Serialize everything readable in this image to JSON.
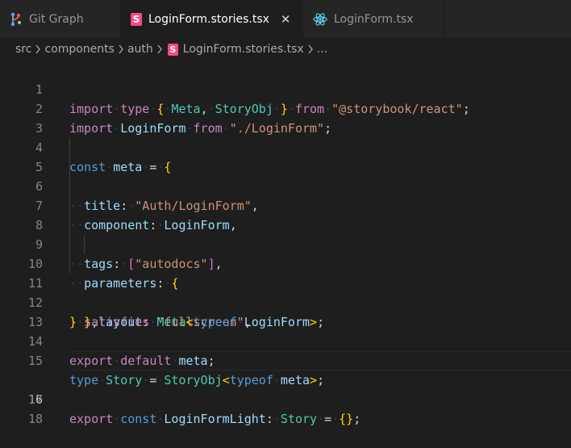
{
  "tabs": [
    {
      "label": "Git Graph",
      "icon": "git-graph-icon"
    },
    {
      "label": "LoginForm.stories.tsx",
      "icon": "storybook-icon",
      "active": true,
      "close": "✕"
    },
    {
      "label": "LoginForm.tsx",
      "icon": "react-icon"
    }
  ],
  "breadcrumb": {
    "parts": [
      "src",
      "components",
      "auth",
      "LoginForm.stories.tsx",
      "..."
    ],
    "file_icon_letter": "S"
  },
  "line_numbers": [
    "1",
    "2",
    "3",
    "4",
    "5",
    "6",
    "7",
    "8",
    "9",
    "10",
    "11",
    "12",
    "13",
    "14",
    "15",
    "16",
    "17",
    "18"
  ],
  "code": {
    "l1": {
      "import": "import",
      "type": "type",
      "ob": "{",
      "meta": "Meta",
      "comma": ",",
      "storyobj": "StoryObj",
      "cb": "}",
      "from": "from",
      "src": "\"@storybook/react\"",
      "semi": ";"
    },
    "l2": {
      "import": "import",
      "name": "LoginForm",
      "from": "from",
      "src": "\"./LoginForm\"",
      "semi": ";"
    },
    "l4": {
      "const": "const",
      "name": "meta",
      "eq": "=",
      "ob": "{"
    },
    "l5": {
      "key": "title",
      "colon": ":",
      "val": "\"Auth/LoginForm\"",
      "comma": ","
    },
    "l6": {
      "key": "component",
      "colon": ":",
      "val": "LoginForm",
      "comma": ","
    },
    "l8": {
      "key": "tags",
      "colon": ":",
      "ob": "[",
      "val": "\"autodocs\"",
      "cb": "]",
      "comma": ","
    },
    "l9": {
      "key": "parameters",
      "colon": ":",
      "ob": "{"
    },
    "l10": {
      "key": "layout",
      "colon": ":",
      "val": "\"fullscreen\"",
      "comma": ","
    },
    "l11": {
      "cb": "}",
      "comma": ","
    },
    "l12": {
      "cb": "}",
      "satisfies": "satisfies",
      "type": "Meta",
      "lt": "<",
      "typeof": "typeof",
      "name": "LoginForm",
      "gt": ">",
      "semi": ";"
    },
    "l14": {
      "export": "export",
      "default": "default",
      "name": "meta",
      "semi": ";"
    },
    "l15": {
      "type": "type",
      "name": "Story",
      "eq": "=",
      "storyobj": "StoryObj",
      "lt": "<",
      "typeof": "typeof",
      "meta": "meta",
      "gt": ">",
      "semi": ";"
    },
    "l17": {
      "export": "export",
      "const": "const",
      "name": "LoginFormLight",
      "colon": ":",
      "type": "Story",
      "eq": "=",
      "obj": "{}",
      "semi": ";"
    }
  },
  "colors": {
    "background": "#1e1e1e",
    "tabbar": "#252526",
    "storybook": "#ff4785",
    "react": "#61dafb"
  }
}
